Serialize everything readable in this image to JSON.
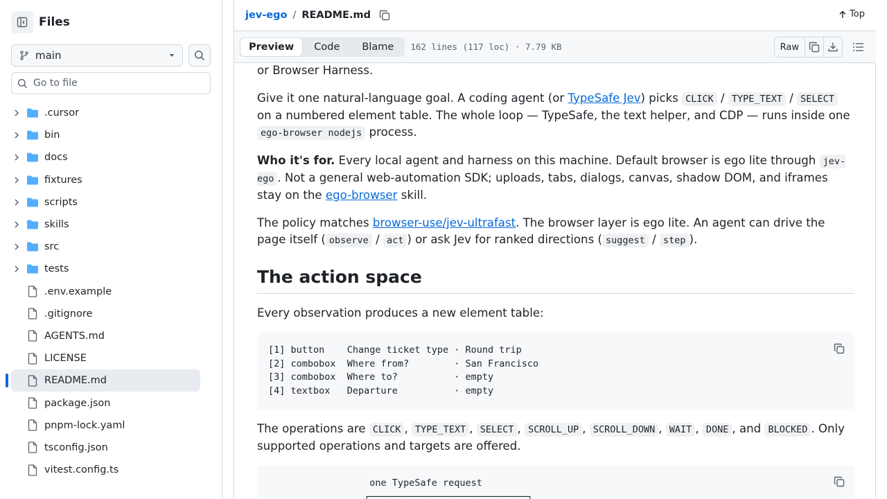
{
  "sidebar": {
    "title": "Files",
    "branch": "main",
    "goto_placeholder": "Go to file",
    "items": [
      {
        "name": ".cursor",
        "type": "dir"
      },
      {
        "name": "bin",
        "type": "dir"
      },
      {
        "name": "docs",
        "type": "dir"
      },
      {
        "name": "fixtures",
        "type": "dir"
      },
      {
        "name": "scripts",
        "type": "dir"
      },
      {
        "name": "skills",
        "type": "dir"
      },
      {
        "name": "src",
        "type": "dir"
      },
      {
        "name": "tests",
        "type": "dir"
      },
      {
        "name": ".env.example",
        "type": "file"
      },
      {
        "name": ".gitignore",
        "type": "file"
      },
      {
        "name": "AGENTS.md",
        "type": "file"
      },
      {
        "name": "LICENSE",
        "type": "file"
      },
      {
        "name": "README.md",
        "type": "file",
        "selected": true
      },
      {
        "name": "package.json",
        "type": "file"
      },
      {
        "name": "pnpm-lock.yaml",
        "type": "file"
      },
      {
        "name": "tsconfig.json",
        "type": "file"
      },
      {
        "name": "vitest.config.ts",
        "type": "file"
      }
    ]
  },
  "header": {
    "repo": "jev-ego",
    "separator": "/",
    "file": "README.md",
    "top_label": "Top"
  },
  "toolbar": {
    "tabs": [
      "Preview",
      "Code",
      "Blame"
    ],
    "active_tab": "Preview",
    "meta": "162 lines (117 loc) · 7.79 KB",
    "raw_label": "Raw"
  },
  "content": {
    "p0": "or Browser Harness.",
    "p1": {
      "a": "Give it one natural-language goal. A coding agent (or ",
      "link": "TypeSafe Jev",
      "b": ") picks ",
      "c1": "CLICK",
      "s1": " / ",
      "c2": "TYPE_TEXT",
      "s2": " / ",
      "c3": "SELECT",
      "d": " on a numbered element table. The whole loop — TypeSafe, the text helper, and CDP — runs inside one ",
      "c4": "ego-browser nodejs",
      "e": " process."
    },
    "p2": {
      "strong": "Who it's for.",
      "a": " Every local agent and harness on this machine. Default browser is ego lite through ",
      "c1": "jev-ego",
      "b": ". Not a general web-automation SDK; uploads, tabs, dialogs, canvas, shadow DOM, and iframes stay on the ",
      "link": "ego-browser",
      "c": " skill."
    },
    "p3": {
      "a": "The policy matches ",
      "link": "browser-use/jev-ultrafast",
      "b": ". The browser layer is ego lite. An agent can drive the page itself (",
      "c1": "observe",
      "s1": " / ",
      "c2": "act",
      "c": ") or ask Jev for ranked directions (",
      "c3": "suggest",
      "s2": " / ",
      "c4": "step",
      "d": ")."
    },
    "h2": "The action space",
    "p4": "Every observation produces a new element table:",
    "code1": "[1] button    Change ticket type · Round trip\n[2] combobox  Where from?        · San Francisco\n[3] combobox  Where to?          · empty\n[4] textbox   Departure          · empty",
    "p5": {
      "a": "The operations are ",
      "c1": "CLICK",
      "s1": ", ",
      "c2": "TYPE_TEXT",
      "s2": ", ",
      "c3": "SELECT",
      "s3": ", ",
      "c4": "SCROLL_UP",
      "s4": ", ",
      "c5": "SCROLL_DOWN",
      "s5": ", ",
      "c6": "WAIT",
      "s6": ", ",
      "c7": "DONE",
      "s7": ", and ",
      "c8": "BLOCKED",
      "b": ". Only supported operations and targets are offered."
    },
    "code2": "                  one TypeSafe request\n                 ┌────────────────────────────┐"
  }
}
